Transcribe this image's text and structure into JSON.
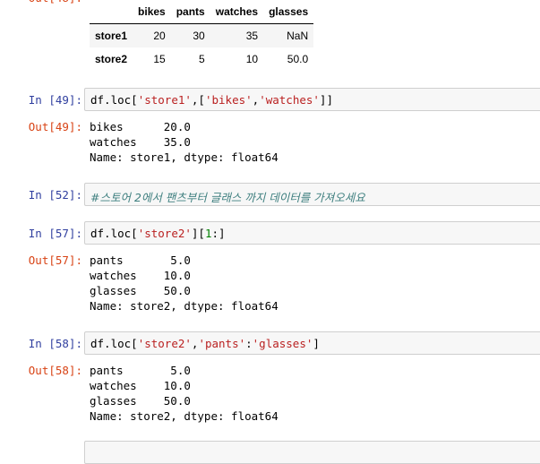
{
  "table": {
    "columns": [
      "",
      "bikes",
      "pants",
      "watches",
      "glasses"
    ],
    "rows": [
      {
        "index": "store1",
        "values": [
          "20",
          "30",
          "35",
          "NaN"
        ]
      },
      {
        "index": "store2",
        "values": [
          "15",
          "5",
          "10",
          "50.0"
        ]
      }
    ]
  },
  "cells": [
    {
      "in_prompt": "In [49]:",
      "code": [
        "df.loc[",
        "'store1'",
        ",[",
        "'bikes'",
        ",",
        "'watches'",
        "]]"
      ],
      "out_prompt": "Out[49]:",
      "output": "bikes      20.0\nwatches    35.0\nName: store1, dtype: float64"
    },
    {
      "in_prompt": "In [52]:",
      "comment": "#스토어 2에서 팬츠부터 글래스 까지 데이터를 가져오세요"
    },
    {
      "in_prompt": "In [57]:",
      "code": [
        "df.loc[",
        "'store2'",
        "][",
        "1",
        ":]"
      ],
      "out_prompt": "Out[57]:",
      "output": "pants       5.0\nwatches    10.0\nglasses    50.0\nName: store2, dtype: float64"
    },
    {
      "in_prompt": "In [58]:",
      "code": [
        "df.loc[",
        "'store2'",
        ",",
        "'pants'",
        ":",
        "'glasses'",
        "]"
      ],
      "out_prompt": "Out[58]:",
      "output": "pants       5.0\nwatches    10.0\nglasses    50.0\nName: store2, dtype: float64"
    }
  ]
}
